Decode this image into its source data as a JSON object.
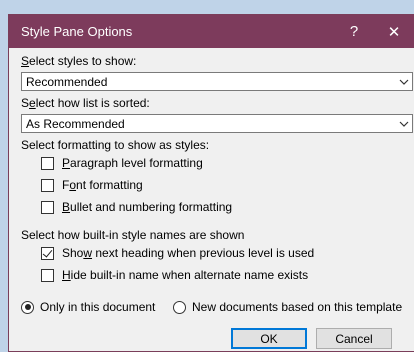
{
  "dialog": {
    "title": "Style Pane Options",
    "help_label": "?",
    "close_label": "✕"
  },
  "styles_to_show": {
    "label_u": "S",
    "label_rest": "elect styles to show:",
    "value": "Recommended"
  },
  "sort": {
    "label_pre": "S",
    "label_u": "e",
    "label_rest": "lect how list is sorted:",
    "value": "As Recommended"
  },
  "formatting": {
    "label": "Select formatting to show as styles:",
    "options": [
      {
        "u": "P",
        "rest": "aragraph level formatting",
        "checked": false
      },
      {
        "pre": "F",
        "u": "o",
        "rest": "nt formatting",
        "checked": false
      },
      {
        "u": "B",
        "rest": "ullet and numbering formatting",
        "checked": false
      }
    ]
  },
  "builtin": {
    "label": "Select how built-in style names are shown",
    "options": [
      {
        "pre": "Sho",
        "u": "w",
        "rest": " next heading when previous level is used",
        "checked": true
      },
      {
        "u": "H",
        "rest": "ide built-in name when alternate name exists",
        "checked": false
      }
    ]
  },
  "scope": {
    "only_label": "Only in this document",
    "new_label": "New documents based on this template",
    "selected": "only"
  },
  "buttons": {
    "ok": "OK",
    "cancel": "Cancel"
  }
}
